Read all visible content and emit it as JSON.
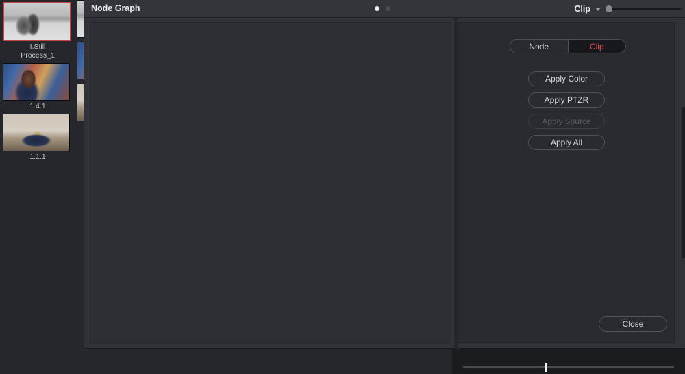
{
  "window": {
    "title": "Node Graph",
    "page_dots": [
      {
        "name": "page-dot-1",
        "active": true
      },
      {
        "name": "page-dot-2",
        "active": false
      }
    ],
    "toolbar_right": {
      "mode_label": "Clip",
      "chevron_icon": "chevron-down-icon",
      "zoom_slider_value": 0
    }
  },
  "gallery": {
    "column_a": [
      {
        "label": "I.Still\nProcess_1",
        "selected": true,
        "image": "wedding-couple-bw"
      },
      {
        "label": "1.4.1",
        "selected": false,
        "image": "woman-portrait"
      },
      {
        "label": "1.1.1",
        "selected": false,
        "image": "room-interior"
      }
    ],
    "column_b": [
      {
        "label": "",
        "selected": false,
        "image": "wedding-couple-bw"
      },
      {
        "label": "",
        "selected": false,
        "image": "woman-portrait"
      },
      {
        "label": "",
        "selected": false,
        "image": "room-interior"
      }
    ]
  },
  "right_panel": {
    "toggle": {
      "options": [
        "Node",
        "Clip"
      ],
      "selected": "Clip",
      "active_color": "#e0484f"
    },
    "buttons": [
      {
        "label": "Apply Color",
        "enabled": true
      },
      {
        "label": "Apply PTZR",
        "enabled": true
      },
      {
        "label": "Apply Source",
        "enabled": false
      },
      {
        "label": "Apply All",
        "enabled": true
      }
    ],
    "close_label": "Close"
  },
  "bottom": {
    "scrubber_value": 39
  },
  "colors": {
    "app_background": "#212227",
    "panel_background": "#2a2b31",
    "canvas_background": "#2e2f34",
    "titlebar_background": "#34353b",
    "accent_red": "#e0484f",
    "selection_border": "#c0444a",
    "text_primary": "#e9eaee",
    "text_secondary": "#c6c7cb",
    "text_disabled": "#5b5c64"
  }
}
